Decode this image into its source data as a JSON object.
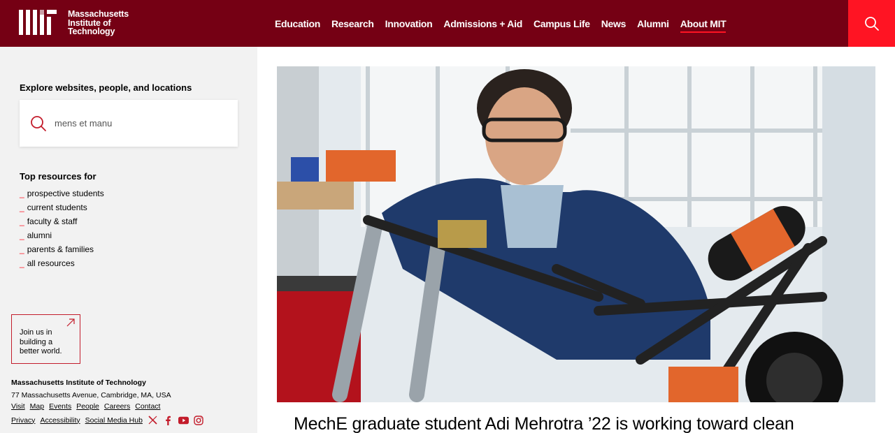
{
  "header": {
    "logo_lines": [
      "Massachusetts",
      "Institute of",
      "Technology"
    ],
    "nav": [
      "Education",
      "Research",
      "Innovation",
      "Admissions + Aid",
      "Campus Life",
      "News",
      "Alumni",
      "About MIT"
    ],
    "active_nav": "About MIT",
    "search_icon": "search-icon"
  },
  "sidebar": {
    "explore_title": "Explore websites, people, and locations",
    "search_value": "mens et manu",
    "top_resources_title": "Top resources for",
    "resources": [
      "prospective students",
      "current students",
      "faculty & staff",
      "alumni",
      "parents & families",
      "all resources"
    ],
    "join_lines": [
      "Join us in",
      "building a",
      "better world."
    ],
    "address_title": "Massachusetts Institute of Technology",
    "address": "77 Massachusetts Avenue, Cambridge, MA, USA",
    "links_row1": [
      "Visit",
      "Map",
      "Events",
      "People",
      "Careers",
      "Contact"
    ],
    "links_row2": [
      "Privacy",
      "Accessibility",
      "Social Media Hub"
    ],
    "social_icons": [
      "x-icon",
      "facebook-icon",
      "youtube-icon",
      "instagram-icon"
    ]
  },
  "main": {
    "headline": "MechE graduate student Adi Mehrotra ’22 is working toward clean"
  },
  "colors": {
    "header_bg": "#750014",
    "accent_red": "#ff1423",
    "sidebar_bg": "#f2f2f2"
  }
}
